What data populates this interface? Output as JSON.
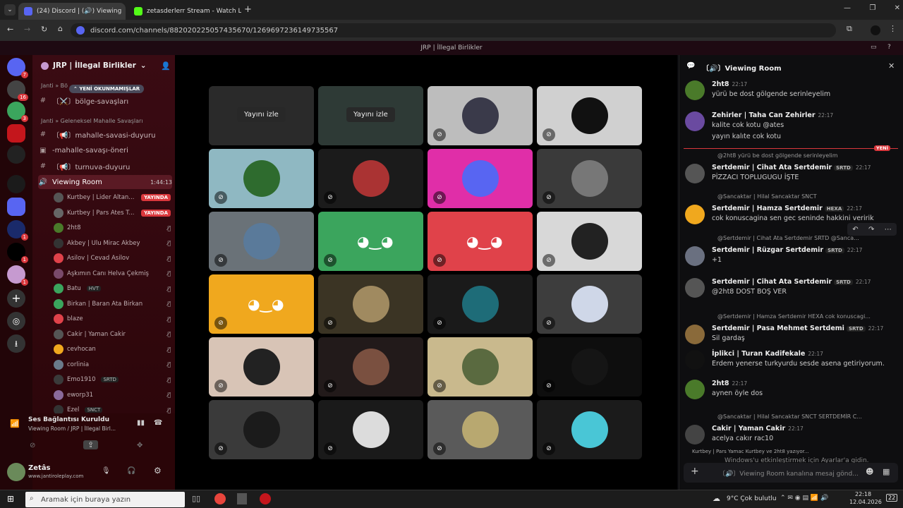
{
  "browser": {
    "tabs": [
      {
        "title": "(24) Discord | (🔊) Viewing"
      },
      {
        "title": "zetasderlerr Stream - Watch Liv"
      }
    ],
    "new_tab": "+",
    "url": "discord.com/channels/882020225057435670/1269697236149735567",
    "win_controls": [
      "—",
      "❐",
      "✕"
    ]
  },
  "discord": {
    "topbar_title": "JRP | İllegal Birlikler",
    "server_name": "JRP | İllegal Birlikler",
    "unread_banner": "YENİ OKUNMAMIŞLAR",
    "server_badges": [
      "7",
      "16",
      "3",
      "1",
      "1",
      "1"
    ],
    "categories": [
      "Janti » Bö",
      "Janti » Geleneksel Mahalle Savaşları"
    ],
    "channels": [
      {
        "name": "〔⚔️〕bölge-savaşları"
      },
      {
        "name": "〔📢〕mahalle-savasi-duyuru"
      },
      {
        "name": "-mahalle-savaşı-öneri"
      },
      {
        "name": "〔📢〕turnuva-duyuru"
      },
      {
        "name": "Viewing Room",
        "time": "1:44:13"
      }
    ],
    "voice_users": [
      {
        "name": "Kurtbey | Lider Altan...",
        "badge": "YAYINDA"
      },
      {
        "name": "Kurtbey | Pars Ates T...",
        "badge": "YAYINDA"
      },
      {
        "name": "2ht8"
      },
      {
        "name": "Akbey | Ulu Mirac Akbey"
      },
      {
        "name": "Asilov | Cevad Asilov"
      },
      {
        "name": "Aşkımın Canı Helva Çekmiş"
      },
      {
        "name": "Batu",
        "tag": "HVT"
      },
      {
        "name": "Birkan | Baran Ata Birkan"
      },
      {
        "name": "blaze"
      },
      {
        "name": "Cakir | Yaman Cakir"
      },
      {
        "name": "cevhocan"
      },
      {
        "name": "corlinia"
      },
      {
        "name": "Emo1910",
        "tag": "SRTD"
      },
      {
        "name": "eworp31"
      },
      {
        "name": "Ezel",
        "tag": "SNCT"
      }
    ],
    "voice_panel": {
      "status": "Ses Bağlantısı Kuruldu",
      "location": "Viewing Room / JRP | İllegal Birl...",
      "user": "Zetâs",
      "user_sub": "www.jantiroleplay.com"
    },
    "stage": {
      "watch_label": "Yayını izle",
      "tiles": [
        {
          "bg": "#2a2a2a",
          "type": "stream"
        },
        {
          "bg": "#2e3a36",
          "type": "stream"
        },
        {
          "bg": "#bdbdbd",
          "type": "avatar",
          "c": "#3a3a4a"
        },
        {
          "bg": "#d0d0d0",
          "type": "avatar",
          "c": "#111"
        },
        {
          "bg": "#8fb8c2",
          "type": "avatar",
          "c": "#2e6b2e"
        },
        {
          "bg": "#1b1b1b",
          "type": "avatar",
          "c": "#a33"
        },
        {
          "bg": "#e02ea8",
          "type": "avatar",
          "c": "#5865f2"
        },
        {
          "bg": "#3a3a3a",
          "type": "avatar",
          "c": "#777"
        },
        {
          "bg": "#6a7278",
          "type": "avatar",
          "c": "#5a7a9a"
        },
        {
          "bg": "#3ba55d",
          "type": "discord"
        },
        {
          "bg": "#e0424a",
          "type": "discord"
        },
        {
          "bg": "#d8d8d8",
          "type": "avatar",
          "c": "#222"
        },
        {
          "bg": "#f0a81e",
          "type": "discord"
        },
        {
          "bg": "#3b3424",
          "type": "avatar",
          "c": "#a08a60"
        },
        {
          "bg": "#1a1a1a",
          "type": "avatar",
          "c": "#1e6c78"
        },
        {
          "bg": "#3d3d3d",
          "type": "avatar",
          "c": "#cfd7e8"
        },
        {
          "bg": "#d8c4b6",
          "type": "avatar",
          "c": "#222"
        },
        {
          "bg": "#221a1a",
          "type": "avatar",
          "c": "#7a5040"
        },
        {
          "bg": "#c9b98d",
          "type": "avatar",
          "c": "#5a6a40"
        },
        {
          "bg": "#0e0e0e",
          "type": "avatar",
          "c": "#151515"
        },
        {
          "bg": "#3a3a3a",
          "type": "avatar",
          "c": "#1b1b1b"
        },
        {
          "bg": "#1a1a1a",
          "type": "avatar",
          "c": "#dcdcdc"
        },
        {
          "bg": "#5a5a5a",
          "type": "avatar",
          "c": "#b8a870"
        },
        {
          "bg": "#1b1b1b",
          "type": "avatar",
          "c": "#49c6d6"
        }
      ]
    },
    "chat": {
      "title": "〔🔊〕Viewing Room",
      "new_label": "YENİ",
      "messages": [
        {
          "name": "2ht8",
          "time": "22:17",
          "text": "yürü be dost gölgende serinleyelim",
          "av": "#4a7a2a"
        },
        {
          "name": "Zehirler | Taha Can Zehirler",
          "time": "22:17",
          "text": "kalite cok kotu @ates",
          "text2": "yayın kalıte cok kotu",
          "av": "#6a4aa0"
        },
        {
          "reply": "@2ht8 yürü be dost gölgende serinleyelim",
          "name": "Sertdemir | Cihat Ata Sertdemir",
          "tag": "SRTD",
          "time": "22:17",
          "text": "PİZZACI TOPLUGUGU İŞTE",
          "av": "#555"
        },
        {
          "reply": "@Sancaktar | Hilal Sancaktar  SNCT",
          "name": "Sertdemir | Hamza Sertdemir",
          "tag": "HEXA",
          "time": "22:17",
          "text": "cok konuscagina sen gec seninde hakkini veririk",
          "av": "#f0a81e"
        },
        {
          "reply": "@Sertdemir | Cihat Ata Sertdemir  SRTD  @Sanca...",
          "name": "Sertdemir | Rüzgar Sertdemir",
          "tag": "SRTD",
          "time": "22:17",
          "text": "+1",
          "av": "#6a7080"
        },
        {
          "name": "Sertdemir | Cihat Ata Sertdemir",
          "tag": "SRTD",
          "time": "22:17",
          "text": "@2ht8 DOST BOŞ VER",
          "av": "#555"
        },
        {
          "reply": "@Sertdemir | Hamza Sertdemir  HEXA  cok konuscagi...",
          "name": "Sertdemir | Pasa Mehmet Sertdemi",
          "tag": "SRTD",
          "time": "22:17",
          "text": "Sil gardaş",
          "av": "#8a6a3a"
        },
        {
          "name": "İplikci | Turan Kadifekale",
          "time": "22:17",
          "text": "Erdem yenerse turkyurdu sesde asena getiriyorum.",
          "av": "#111"
        },
        {
          "name": "2ht8",
          "time": "22:17",
          "text": "aynen öyle dos",
          "av": "#4a7a2a"
        },
        {
          "reply": "@Sancaktar | Hilal Sancaktar  SNCT  SERTDEMİR C...",
          "name": "Cakir | Yaman Cakir",
          "time": "22:17",
          "text": "acelya cakır rac10",
          "av": "#444"
        }
      ],
      "typing": "Kurtbey | Pars Yamac Kurtbey ve 2ht8 yazıyor...",
      "activate_win": "Windows'u etkinleştirmek için Ayarlar'a gidin.",
      "input_placeholder": "〔🔊〕Viewing Room kanalına mesaj gönd..."
    }
  },
  "taskbar": {
    "search_placeholder": "Aramak için buraya yazın",
    "weather": "9°C  Çok bulutlu",
    "time": "22:18",
    "date": "12.04.2026",
    "notif": "22"
  }
}
